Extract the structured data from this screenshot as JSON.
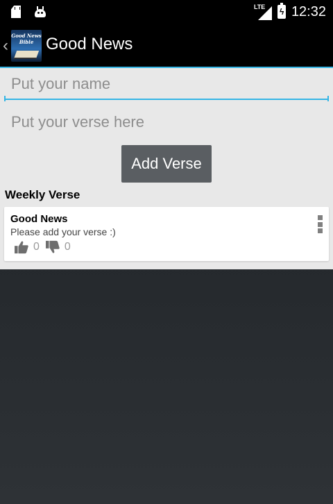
{
  "status_bar": {
    "network_label": "LTE",
    "time": "12:32",
    "icons": [
      "sd-card-icon",
      "android-icon",
      "signal-icon",
      "battery-charging-icon"
    ]
  },
  "action_bar": {
    "title": "Good News",
    "app_icon_text_line1": "Good News",
    "app_icon_text_line2": "Bible"
  },
  "form": {
    "name_placeholder": "Put your name",
    "name_value": "",
    "verse_placeholder": "Put your verse here",
    "verse_value": "",
    "add_button_label": "Add Verse"
  },
  "weekly": {
    "section_title": "Weekly Verse",
    "cards": [
      {
        "title": "Good News",
        "text": "Please add your verse :)",
        "likes": "0",
        "dislikes": "0"
      }
    ]
  },
  "colors": {
    "accent": "#33b5e5",
    "button": "#5a5e62",
    "panel_bg": "#e8e8e8"
  }
}
